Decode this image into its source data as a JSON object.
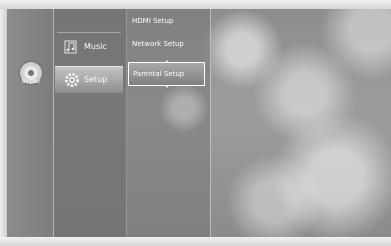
{
  "disc": {
    "status_label": "No Disc",
    "icon": "disc-icon"
  },
  "main_menu": {
    "items": [
      {
        "label": "Music",
        "icon": "music-note-icon",
        "selected": false
      },
      {
        "label": "Setup",
        "icon": "gear-icon",
        "selected": true
      }
    ]
  },
  "setup_menu": {
    "items": [
      {
        "label": "HDMI Setup",
        "selected": false
      },
      {
        "label": "Network Setup",
        "selected": false
      },
      {
        "label": "Parental Setup",
        "selected": true
      }
    ]
  },
  "colors": {
    "highlight_border": "#ffffff",
    "text": "#ffffff",
    "background": "#9a9a9a"
  }
}
